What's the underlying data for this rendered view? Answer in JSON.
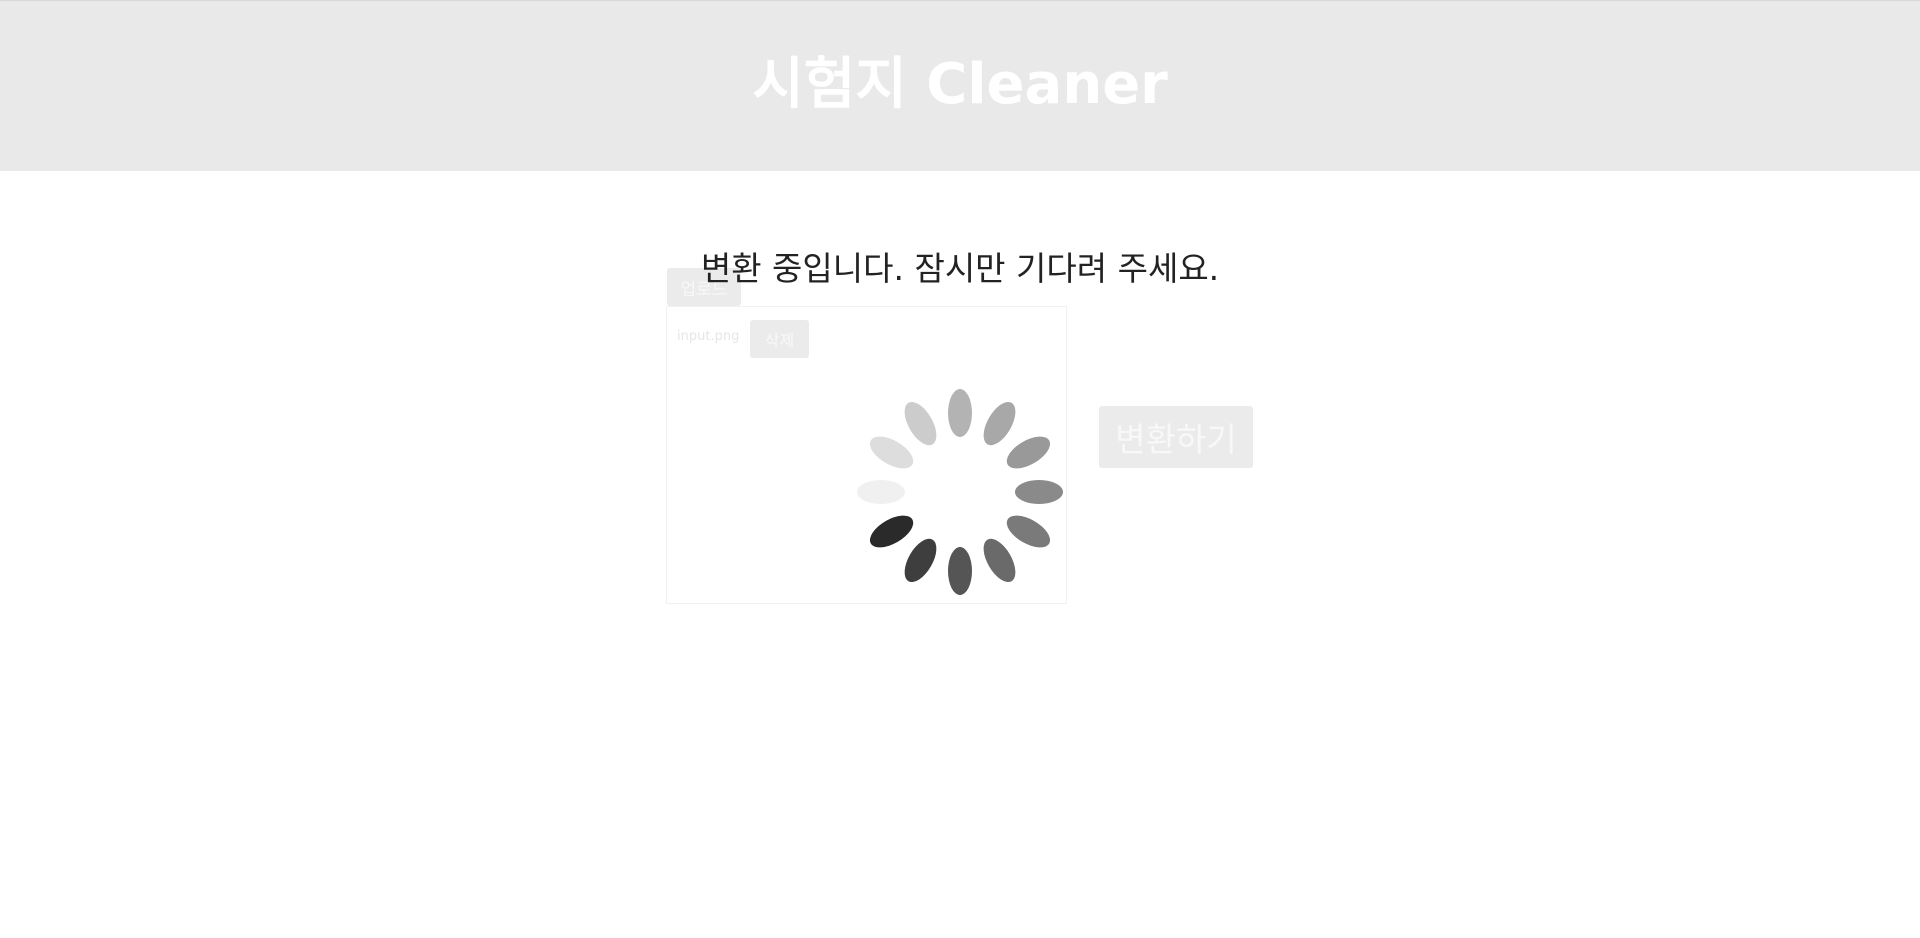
{
  "header": {
    "title": "시험지 Cleaner"
  },
  "uploader": {
    "upload_label": "업로드",
    "file_name": "input.png",
    "delete_label": "삭제"
  },
  "convert_label": "변환하기",
  "loading": {
    "message": "변환 중입니다. 잠시만 기다려 주세요.",
    "spinner_icon": "loading-spinner-icon"
  },
  "colors": {
    "header_bg": "#e9e9e9",
    "button_bg": "#ebebeb",
    "text_dark": "#222222"
  }
}
